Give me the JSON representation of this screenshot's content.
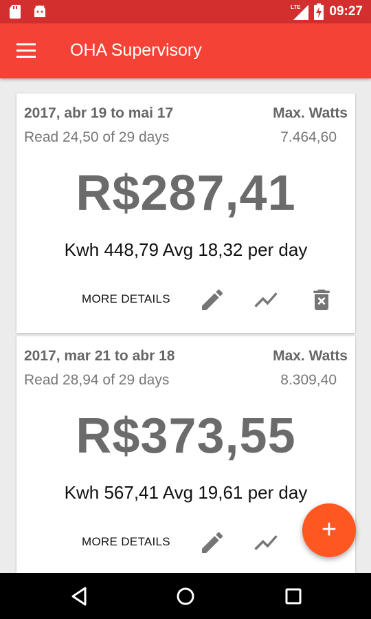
{
  "status_bar": {
    "time": "09:27",
    "network": "LTE"
  },
  "app_bar": {
    "title": "OHA Supervisory"
  },
  "cards": [
    {
      "period": "2017, abr 19 to mai 17",
      "max_label": "Max. Watts",
      "read": "Read 24,50 of 29 days",
      "max_value": "7.464,60",
      "amount": "R$287,41",
      "summary": "Kwh 448,79 Avg 18,32 per day",
      "more_details": "MORE DETAILS"
    },
    {
      "period": "2017, mar 21 to abr 18",
      "max_label": "Max. Watts",
      "read": "Read 28,94 of 29 days",
      "max_value": "8.309,40",
      "amount": "R$373,55",
      "summary": "Kwh 567,41 Avg 19,61 per day",
      "more_details": "MORE DETAILS"
    }
  ],
  "fab": {
    "label": "+"
  },
  "colors": {
    "status_bar": "#d32f2f",
    "app_bar": "#f44336",
    "fab": "#ff5722",
    "icon": "#757575"
  }
}
